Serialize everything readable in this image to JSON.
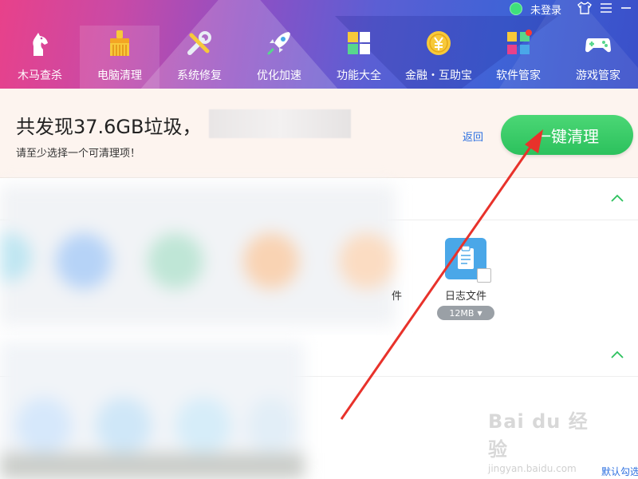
{
  "status": {
    "login_label": "未登录",
    "icons": [
      "online-dot",
      "skin-icon",
      "menu-icon",
      "minimize-icon"
    ]
  },
  "nav": {
    "items": [
      {
        "label": "木马查杀",
        "icon": "horse-icon"
      },
      {
        "label": "电脑清理",
        "icon": "broom-icon",
        "active": true
      },
      {
        "label": "系统修复",
        "icon": "tools-icon"
      },
      {
        "label": "优化加速",
        "icon": "rocket-icon"
      },
      {
        "label": "功能大全",
        "icon": "grid-icon"
      },
      {
        "label": "金融・互助宝",
        "icon": "coin-icon"
      },
      {
        "label": "软件管家",
        "icon": "software-icon"
      },
      {
        "label": "游戏管家",
        "icon": "gamepad-icon"
      }
    ]
  },
  "summary": {
    "headline": "共发现37.6GB垃圾，",
    "hint": "请至少选择一个可清理项！",
    "back_label": "返回",
    "clean_button": "一键清理"
  },
  "items": {
    "log_file": {
      "name": "日志文件",
      "size": "12MB"
    },
    "cut_char": "件"
  },
  "watermark": {
    "logo": "Bai du 经验",
    "sub": "jingyan.baidu.com"
  },
  "footer": {
    "link": "默认勾选"
  },
  "colors": {
    "accent_green": "#2cc15d",
    "link_blue": "#2b6fe0",
    "arrow_red": "#e8322b"
  }
}
